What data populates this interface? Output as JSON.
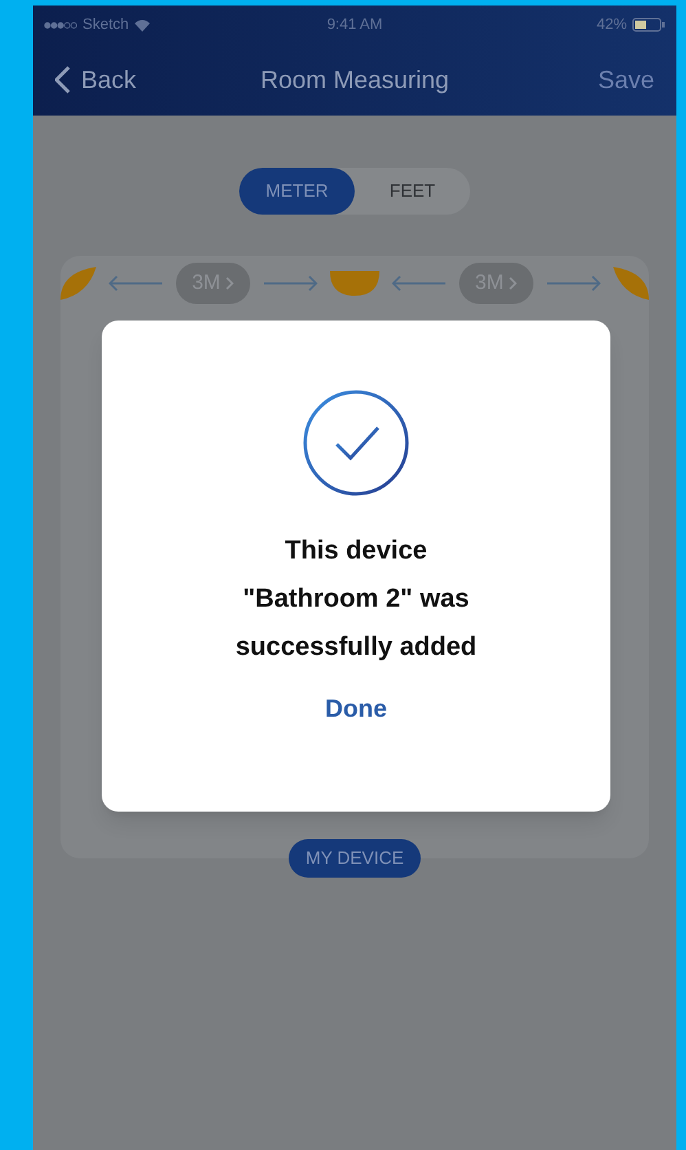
{
  "status_bar": {
    "carrier": "Sketch",
    "time": "9:41 AM",
    "battery": "42%"
  },
  "nav": {
    "back": "Back",
    "title": "Room Measuring",
    "action": "Save"
  },
  "units": [
    {
      "label": "METER",
      "selected": true
    },
    {
      "label": "FEET",
      "selected": false
    }
  ],
  "distances": [
    "3M",
    "3M"
  ],
  "device_button": "MY DEVICE",
  "dialog": {
    "message": "This device\n\"Bathroom 2\" was\nsuccessfully added",
    "button": "Done"
  }
}
